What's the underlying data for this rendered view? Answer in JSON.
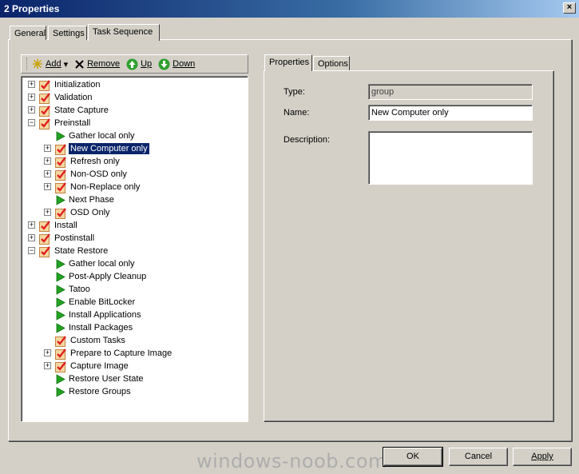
{
  "window": {
    "title": "2 Properties",
    "close_glyph": "×"
  },
  "tabs": [
    {
      "label": "General"
    },
    {
      "label": "Settings"
    },
    {
      "label": "Task Sequence"
    }
  ],
  "toolbar": {
    "add": "Add",
    "add_arrow": "▾",
    "remove": "Remove",
    "up": "Up",
    "down": "Down"
  },
  "tree": {
    "items": [
      {
        "label": "Initialization",
        "type": "group",
        "expander": "+"
      },
      {
        "label": "Validation",
        "type": "group",
        "expander": "+"
      },
      {
        "label": "State Capture",
        "type": "group",
        "expander": "+"
      },
      {
        "label": "Preinstall",
        "type": "group",
        "expander": "−"
      },
      {
        "label": "Gather local only",
        "type": "step"
      },
      {
        "label": "New Computer only",
        "type": "group",
        "expander": "+",
        "selected": true
      },
      {
        "label": "Refresh only",
        "type": "group",
        "expander": "+"
      },
      {
        "label": "Non-OSD only",
        "type": "group",
        "expander": "+"
      },
      {
        "label": "Non-Replace only",
        "type": "group",
        "expander": "+"
      },
      {
        "label": "Next Phase",
        "type": "step"
      },
      {
        "label": "OSD Only",
        "type": "group",
        "expander": "+"
      },
      {
        "label": "Install",
        "type": "group",
        "expander": "+"
      },
      {
        "label": "Postinstall",
        "type": "group",
        "expander": "+"
      },
      {
        "label": "State Restore",
        "type": "group",
        "expander": "−"
      },
      {
        "label": "Gather local only",
        "type": "step"
      },
      {
        "label": "Post-Apply Cleanup",
        "type": "step"
      },
      {
        "label": "Tatoo",
        "type": "step"
      },
      {
        "label": "Enable BitLocker",
        "type": "step"
      },
      {
        "label": "Install Applications",
        "type": "step"
      },
      {
        "label": "Install Packages",
        "type": "step"
      },
      {
        "label": "Custom Tasks",
        "type": "group"
      },
      {
        "label": "Prepare to Capture Image",
        "type": "group",
        "expander": "+"
      },
      {
        "label": "Capture Image",
        "type": "group",
        "expander": "+"
      },
      {
        "label": "Restore User State",
        "type": "step"
      },
      {
        "label": "Restore Groups",
        "type": "step"
      }
    ]
  },
  "right_tabs": [
    {
      "label": "Properties"
    },
    {
      "label": "Options"
    }
  ],
  "properties": {
    "type_label": "Type:",
    "type_value": "group",
    "name_label": "Name:",
    "name_value": "New Computer only",
    "description_label": "Description:",
    "description_value": ""
  },
  "buttons": {
    "ok": "OK",
    "cancel": "Cancel",
    "apply": "Apply"
  },
  "watermark": "windows-noob.com"
}
